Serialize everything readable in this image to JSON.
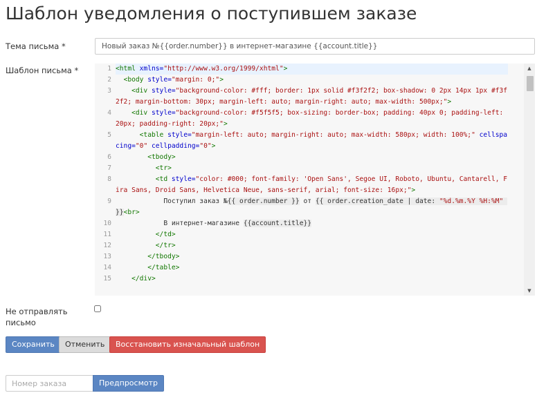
{
  "page": {
    "title": "Шаблон уведомления о поступившем заказе"
  },
  "form": {
    "subject_label": "Тема письма *",
    "subject_value": "Новый заказ №{{order.number}} в интернет-магазине {{account.title}}",
    "template_label": "Шаблон письма *",
    "dont_send_label_line1": "Не отправлять",
    "dont_send_label_line2": "письмо",
    "dont_send_checked": false
  },
  "editor": {
    "active_line": 1,
    "lines": [
      {
        "n": "1",
        "segs": [
          [
            "tag",
            "<html "
          ],
          [
            "attr",
            "xmlns="
          ],
          [
            "str",
            "\"http://www.w3.org/1999/xhtml\""
          ],
          [
            "tag",
            ">"
          ]
        ]
      },
      {
        "n": "2",
        "segs": [
          [
            "txt",
            "  "
          ],
          [
            "tag",
            "<body "
          ],
          [
            "attr",
            "style="
          ],
          [
            "str",
            "\"margin: 0;\""
          ],
          [
            "tag",
            ">"
          ]
        ]
      },
      {
        "n": "3",
        "segs": [
          [
            "txt",
            "    "
          ],
          [
            "tag",
            "<div "
          ],
          [
            "attr",
            "style="
          ],
          [
            "str",
            "\"background-color: #fff; border: 1px solid #f3f2f2; box-shadow: 0 2px 14px 1px #f3f2f2; margin-bottom: 30px; margin-left: auto; margin-right: auto; max-width: 500px;\""
          ],
          [
            "tag",
            ">"
          ]
        ]
      },
      {
        "n": "4",
        "segs": [
          [
            "txt",
            "    "
          ],
          [
            "tag",
            "<div "
          ],
          [
            "attr",
            "style="
          ],
          [
            "str",
            "\"background-color: #f5f5f5; box-sizing: border-box; padding: 40px 0; padding-left: 20px; padding-right: 20px;\""
          ],
          [
            "tag",
            ">"
          ]
        ]
      },
      {
        "n": "5",
        "segs": [
          [
            "txt",
            "      "
          ],
          [
            "tag",
            "<table "
          ],
          [
            "attr",
            "style="
          ],
          [
            "str",
            "\"margin-left: auto; margin-right: auto; max-width: 580px; width: 100%;\""
          ],
          [
            "txt",
            " "
          ],
          [
            "attr",
            "cellspacing="
          ],
          [
            "str",
            "\"0\""
          ],
          [
            "txt",
            " "
          ],
          [
            "attr",
            "cellpadding="
          ],
          [
            "str",
            "\"0\""
          ],
          [
            "tag",
            ">"
          ]
        ]
      },
      {
        "n": "6",
        "segs": [
          [
            "txt",
            "        "
          ],
          [
            "tag",
            "<tbody>"
          ]
        ]
      },
      {
        "n": "7",
        "segs": [
          [
            "txt",
            "          "
          ],
          [
            "tag",
            "<tr>"
          ]
        ]
      },
      {
        "n": "8",
        "segs": [
          [
            "txt",
            "          "
          ],
          [
            "tag",
            "<td "
          ],
          [
            "attr",
            "style="
          ],
          [
            "str",
            "\"color: #000; font-family: 'Open Sans', Segoe UI, Roboto, Ubuntu, Cantarell, Fira Sans, Droid Sans, Helvetica Neue, sans-serif, arial; font-size: 16px;\""
          ],
          [
            "tag",
            ">"
          ]
        ]
      },
      {
        "n": "9",
        "segs": [
          [
            "txt",
            "            Поступил заказ №"
          ],
          [
            "liq",
            "{{ order.number }}"
          ],
          [
            "txt",
            " от "
          ],
          [
            "liq",
            "{{ order.creation_date | date: "
          ],
          [
            "liqstr",
            "\"%d.%m.%Y %H:%M\""
          ],
          [
            "liq",
            " }}"
          ],
          [
            "tag",
            "<br>"
          ]
        ]
      },
      {
        "n": "10",
        "segs": [
          [
            "txt",
            "            В интернет-магазине "
          ],
          [
            "liq",
            "{{account.title}}"
          ]
        ]
      },
      {
        "n": "11",
        "segs": [
          [
            "txt",
            "          "
          ],
          [
            "tag",
            "</td>"
          ]
        ]
      },
      {
        "n": "12",
        "segs": [
          [
            "txt",
            "          "
          ],
          [
            "tag",
            "</tr>"
          ]
        ]
      },
      {
        "n": "13",
        "segs": [
          [
            "txt",
            "        "
          ],
          [
            "tag",
            "</tbody>"
          ]
        ]
      },
      {
        "n": "14",
        "segs": [
          [
            "txt",
            "        "
          ],
          [
            "tag",
            "</table>"
          ]
        ]
      },
      {
        "n": "15",
        "segs": [
          [
            "txt",
            "    "
          ],
          [
            "tag",
            "</div>"
          ]
        ]
      }
    ]
  },
  "buttons": {
    "save": "Сохранить",
    "cancel": "Отменить",
    "restore": "Восстановить изначальный шаблон",
    "preview": "Предпросмотр"
  },
  "preview": {
    "order_placeholder": "Номер заказа"
  },
  "colors": {
    "primary": "#5b86c3",
    "danger": "#d9534f",
    "default": "#dcdcdc",
    "editor_bg": "#f7f7f7",
    "active_line": "#e8f2fe",
    "tag": "#117700",
    "attr": "#0000cc",
    "string": "#aa1111"
  },
  "icons": {
    "scroll_up": "▲",
    "scroll_down": "▼"
  }
}
